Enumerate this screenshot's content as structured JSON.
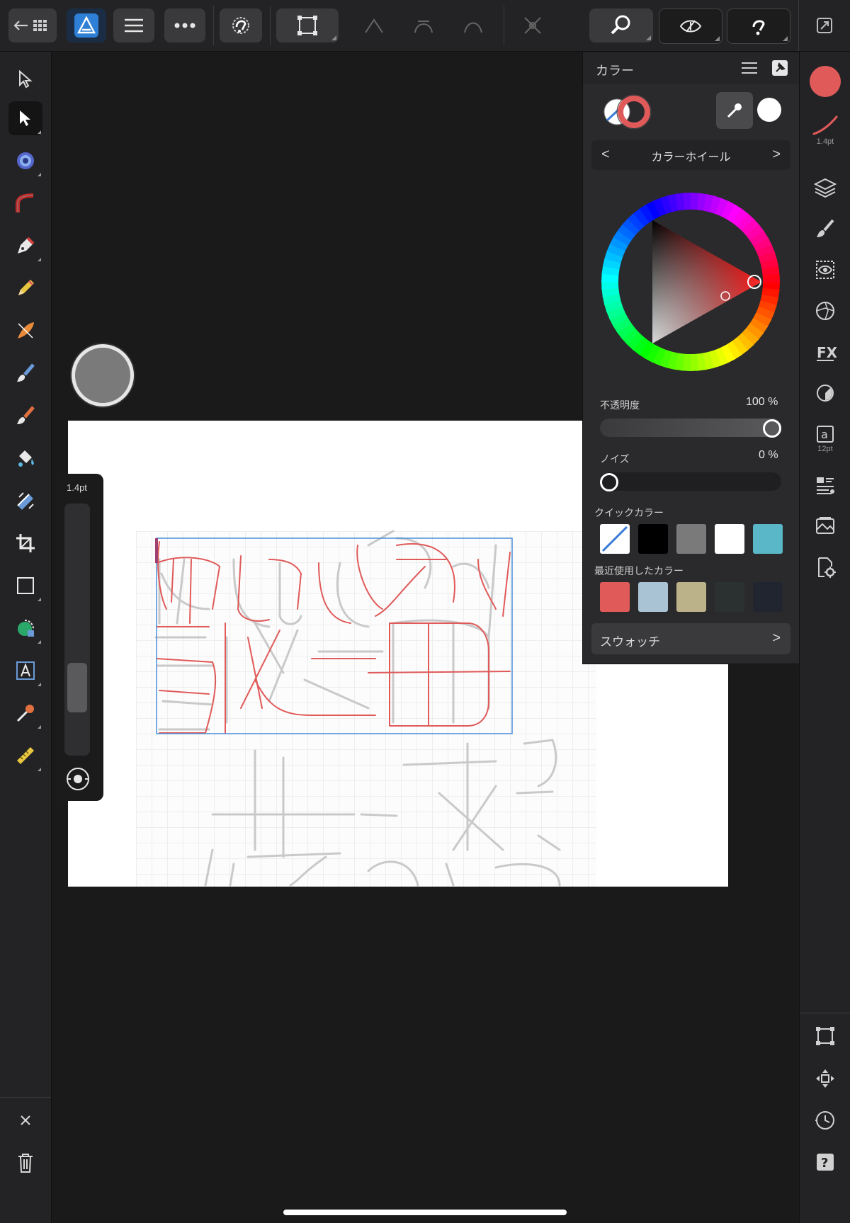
{
  "colors": {
    "accent": "#e05a5a",
    "selection_box": "#4a8fd8",
    "ui_bg": "#232325",
    "canvas_bg": "#1a1a1b"
  },
  "toolbar": {
    "icons": [
      "back-grid-icon",
      "affinity-designer-logo",
      "hamburger-menu-icon",
      "more-icon",
      "snapping-icon",
      "transform-icon",
      "node-sharp-icon",
      "node-smooth-icon",
      "node-smart-icon",
      "node-break-icon",
      "zoom-icon",
      "view-mode-icon",
      "snapping-toggle-icon",
      "fullscreen-icon"
    ]
  },
  "left_tools": {
    "items": [
      "move-tool",
      "node-tool",
      "corner-tool",
      "vector-brush-tool",
      "pen-tool",
      "pencil-tool",
      "vector-brush-2-tool",
      "paint-brush-tool",
      "fill-tool",
      "transparency-tool",
      "crop-tool",
      "rectangle-tool",
      "shape-tool",
      "artistic-text-tool",
      "eyedropper-tool",
      "measure-tool"
    ],
    "bottom": [
      "close-icon",
      "delete-icon"
    ]
  },
  "brush": {
    "size_label": "1.4pt",
    "slider_fraction": 0.2
  },
  "studio": {
    "stroke_size": "1.4pt",
    "text_size": "12pt",
    "items": [
      "layers-icon",
      "brushes-icon",
      "appearance-icon",
      "effects-icon",
      "fx-icon",
      "adjustments-icon",
      "text-styles-icon",
      "styles-icon",
      "assets-icon",
      "export-icon"
    ],
    "bottom": [
      "transform-panel-icon",
      "move-panel-icon",
      "history-icon",
      "help-icon"
    ]
  },
  "color_panel": {
    "title": "カラー",
    "mode": "カラーホイール",
    "mode_prev": "<",
    "mode_next": ">",
    "opacity_label": "不透明度",
    "opacity_value": "100 %",
    "opacity_fraction": 1.0,
    "noise_label": "ノイズ",
    "noise_value": "0 %",
    "noise_fraction": 0.0,
    "quick_colors_label": "クイックカラー",
    "quick_colors": [
      "none",
      "#000000",
      "#7a7a7a",
      "#ffffff",
      "#5ab7c7"
    ],
    "recent_colors_label": "最近使用したカラー",
    "recent_colors": [
      "#e05a5a",
      "#a9c3d4",
      "#bcb28a",
      "#2b3131",
      "#20252f"
    ],
    "swatches_label": "スウォッチ",
    "swatches_arrow": ">",
    "current_color": "#e05a5a"
  }
}
